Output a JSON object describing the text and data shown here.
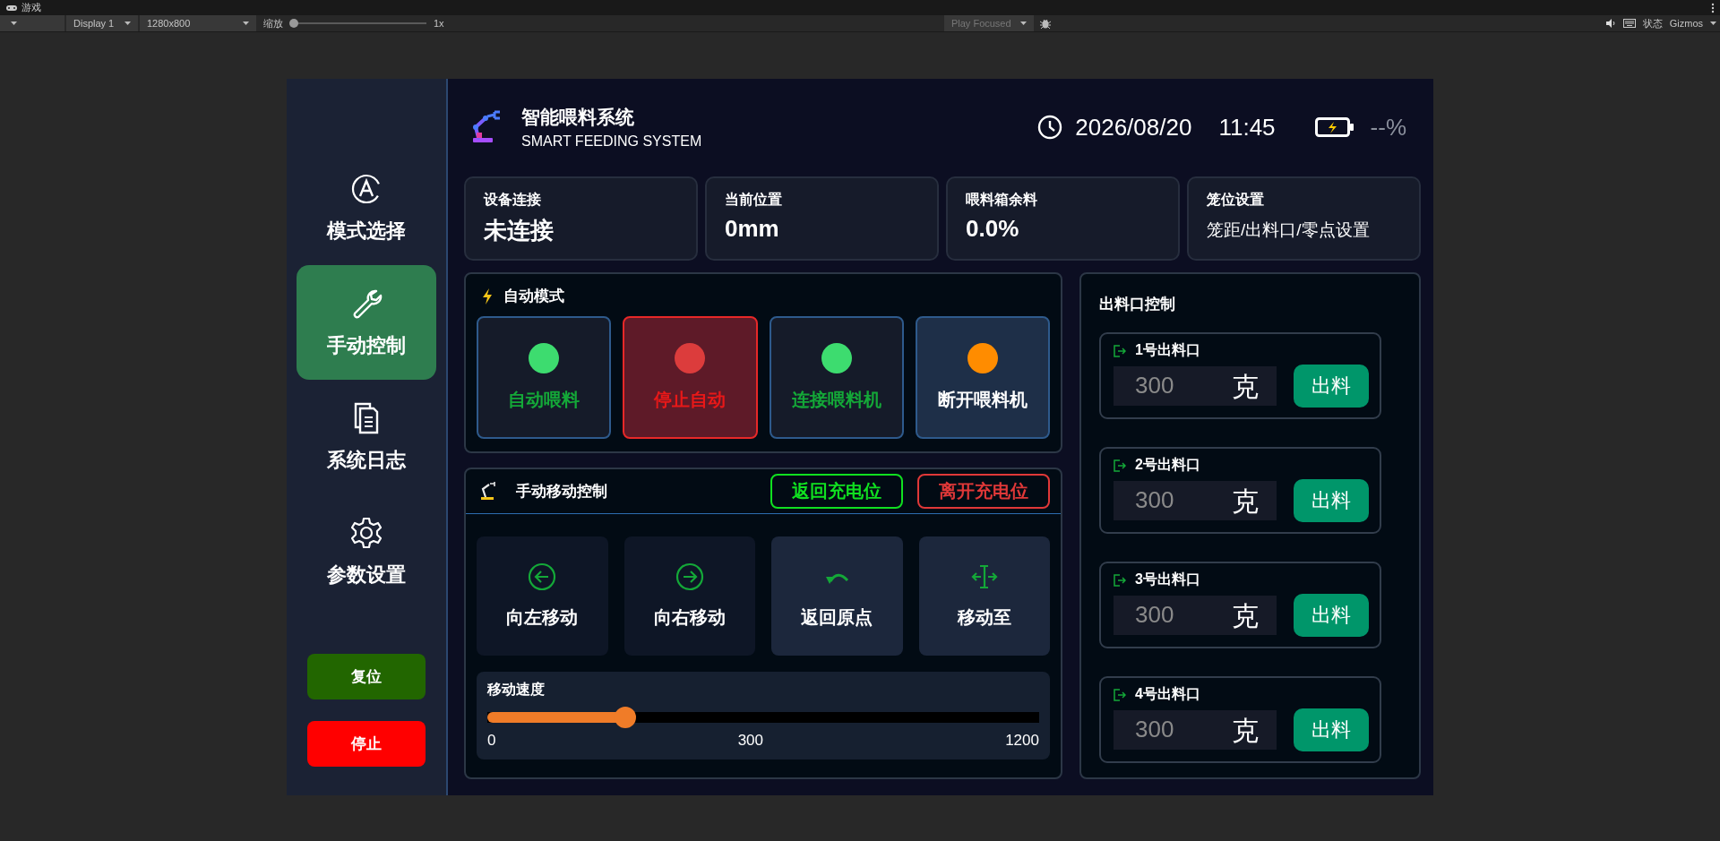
{
  "editor": {
    "title": "游戏",
    "display": "Display 1",
    "resolution": "1280x800",
    "zoom_label": "缩放",
    "zoom": {
      "level": 0
    },
    "zoom_value": "1x",
    "play_mode": "Play Focused",
    "stats": "状态",
    "gizmos": "Gizmos"
  },
  "sidebar": {
    "items": [
      {
        "label": "模式选择",
        "kind": "mode",
        "selected": false
      },
      {
        "label": "手动控制",
        "kind": "manual",
        "selected": true
      },
      {
        "label": "系统日志",
        "kind": "log",
        "selected": false
      },
      {
        "label": "参数设置",
        "kind": "settings",
        "selected": false
      }
    ],
    "buttons": [
      {
        "label": "复位",
        "kind": "reset"
      },
      {
        "label": "停止",
        "kind": "stop"
      }
    ]
  },
  "header": {
    "title": "智能喂料系统",
    "subtitle": "SMART FEEDING SYSTEM",
    "date": "2026/08/20",
    "time": "11:45",
    "battery": "--%"
  },
  "stats": [
    {
      "label": "设备连接",
      "value": "未连接",
      "kind": "metric"
    },
    {
      "label": "当前位置",
      "value": "0mm",
      "kind": "metric"
    },
    {
      "label": "喂料箱余料",
      "value": "0.0%",
      "kind": "metric"
    },
    {
      "label": "笼位设置",
      "value": "笼距/出料口/零点设置",
      "kind": "setting"
    }
  ],
  "auto_mode": {
    "title": "自动模式",
    "buttons": [
      {
        "label": "自动喂料",
        "color": "#3ddc6f",
        "kind": "positive"
      },
      {
        "label": "停止自动",
        "color": "#dc3c3c",
        "kind": "negative"
      },
      {
        "label": "连接喂料机",
        "color": "#3ddc6f",
        "kind": "positive"
      },
      {
        "label": "断开喂料机",
        "color": "#ff8c00",
        "kind": "neutral"
      }
    ]
  },
  "manual": {
    "title": "手动移动控制",
    "charge_buttons": [
      {
        "label": "返回充电位",
        "kind": "return"
      },
      {
        "label": "离开充电位",
        "kind": "leave"
      }
    ],
    "moves": [
      {
        "label": "向左移动",
        "kind": "left"
      },
      {
        "label": "向右移动",
        "kind": "right"
      },
      {
        "label": "返回原点",
        "kind": "home"
      },
      {
        "label": "移动至",
        "kind": "goto"
      }
    ],
    "speed": {
      "label": "移动速度",
      "level": 0.25,
      "ticks": [
        "0",
        "300",
        "1200"
      ]
    }
  },
  "outlets": {
    "title": "出料口控制",
    "items": [
      {
        "label": "1号出料口",
        "placeholder": "300",
        "unit": "克",
        "button": "出料"
      },
      {
        "label": "2号出料口",
        "placeholder": "300",
        "unit": "克",
        "button": "出料"
      },
      {
        "label": "3号出料口",
        "placeholder": "300",
        "unit": "克",
        "button": "出料"
      },
      {
        "label": "4号出料口",
        "placeholder": "300",
        "unit": "克",
        "button": "出料"
      }
    ]
  }
}
